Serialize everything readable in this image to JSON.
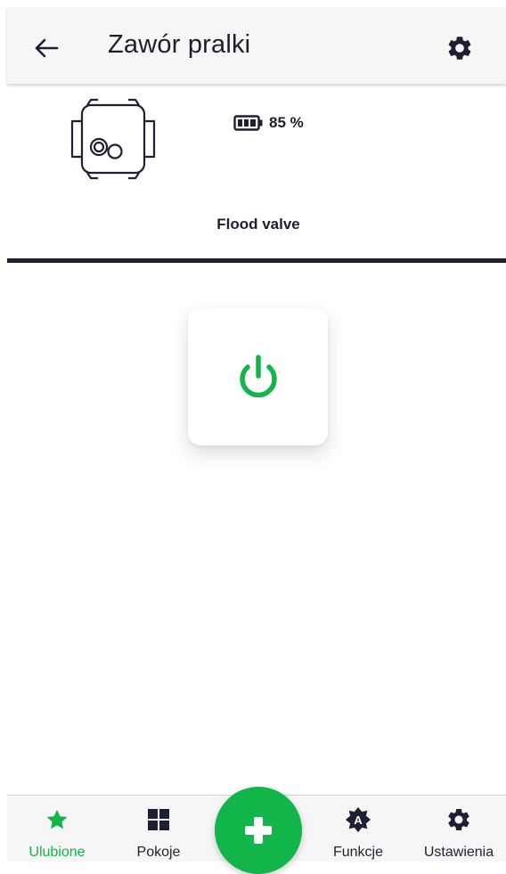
{
  "header": {
    "title": "Zawór pralki",
    "back_icon": "arrow-left-icon",
    "settings_icon": "gear-icon"
  },
  "device": {
    "image_icon": "flood-valve-device-icon",
    "battery_icon": "battery-icon",
    "battery_level": "85 %",
    "type": "Flood valve"
  },
  "control": {
    "power_icon": "power-icon",
    "state_color": "#12b54a"
  },
  "bottom_nav": {
    "items": [
      {
        "label": "Ulubione",
        "icon": "star-icon",
        "active": true
      },
      {
        "label": "Pokoje",
        "icon": "grid-icon",
        "active": false
      },
      {
        "label": "Funkcje",
        "icon": "automation-icon",
        "active": false
      },
      {
        "label": "Ustawienia",
        "icon": "gear-icon",
        "active": false
      }
    ],
    "fab_icon": "plus-icon"
  },
  "colors": {
    "accent": "#12b54a",
    "dark": "#1e1f33",
    "header_bg": "#f6f6f6"
  }
}
